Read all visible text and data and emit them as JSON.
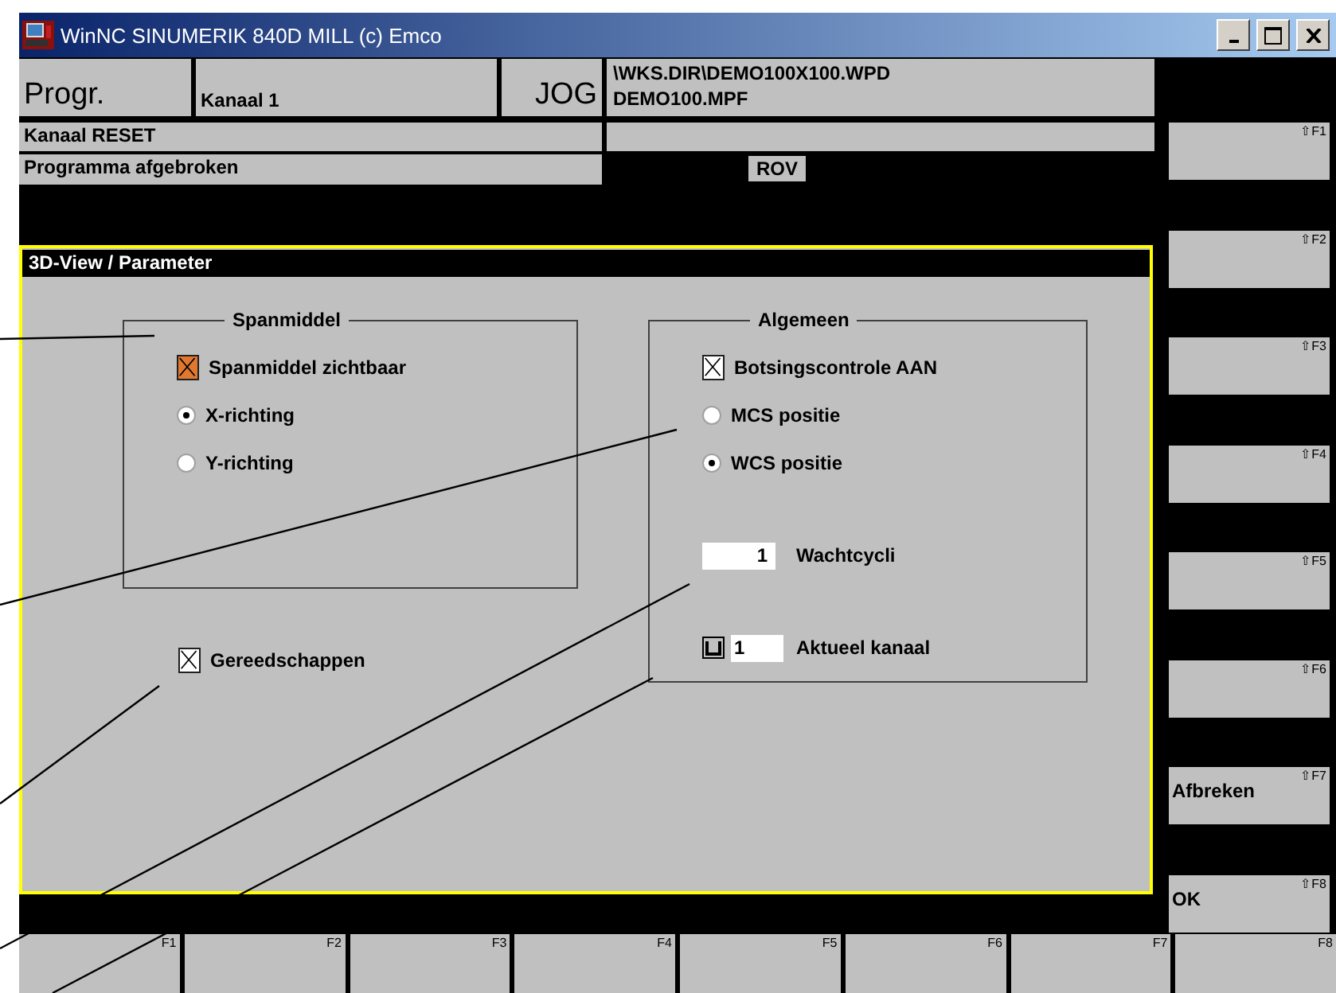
{
  "window": {
    "title": "WinNC SINUMERIK 840D MILL (c) Emco"
  },
  "header": {
    "area": "Progr.",
    "channel": "Kanaal 1",
    "mode": "JOG",
    "path": "\\WKS.DIR\\DEMO100X100.WPD",
    "program": "DEMO100.MPF"
  },
  "status": {
    "channel_state": "Kanaal RESET",
    "program_state": "Programma afgebroken",
    "override": "ROV"
  },
  "dialog": {
    "title": "3D-View / Parameter",
    "groups": [
      {
        "title": "Spanmiddel",
        "items": [
          {
            "kind": "checkbox",
            "label": "Spanmiddel zichtbaar",
            "checked": true,
            "focused": true
          },
          {
            "kind": "radio",
            "label": "X-richting",
            "selected": true
          },
          {
            "kind": "radio",
            "label": "Y-richting",
            "selected": false
          }
        ]
      },
      {
        "title": "Algemeen",
        "items": [
          {
            "kind": "checkbox",
            "label": "Botsingscontrole AAN",
            "checked": true,
            "focused": false
          },
          {
            "kind": "radio",
            "label": "MCS positie",
            "selected": false
          },
          {
            "kind": "radio",
            "label": "WCS positie",
            "selected": true
          },
          {
            "kind": "number",
            "label": "Wachtcycli",
            "value": "1"
          },
          {
            "kind": "channel",
            "label": "Aktueel kanaal",
            "value": "1"
          }
        ]
      }
    ],
    "standalone": {
      "kind": "checkbox",
      "label": "Gereedschappen",
      "checked": true,
      "focused": false
    }
  },
  "vertical_softkeys": [
    {
      "key": "⇧F1"
    },
    {
      "key": "⇧F2"
    },
    {
      "key": "⇧F3"
    },
    {
      "key": "⇧F4"
    },
    {
      "key": "⇧F5"
    },
    {
      "key": "⇧F6"
    },
    {
      "key": "⇧F7",
      "label": "Afbreken"
    },
    {
      "key": "⇧F8",
      "label": "OK"
    }
  ],
  "horizontal_softkeys": [
    "F1",
    "F2",
    "F3",
    "F4",
    "F5",
    "F6",
    "F7",
    "F8"
  ]
}
